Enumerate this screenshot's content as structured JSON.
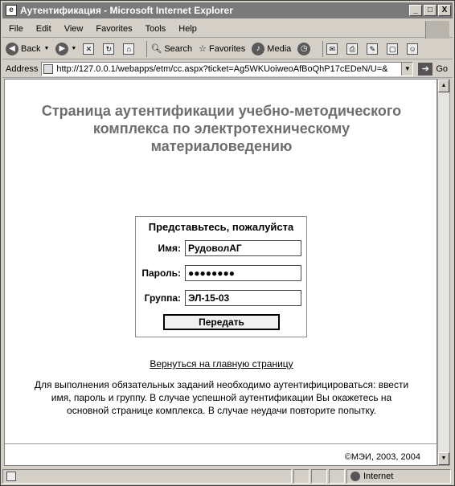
{
  "window": {
    "title": "Аутентификация - Microsoft Internet Explorer",
    "minimize": "_",
    "maximize": "□",
    "close": "X"
  },
  "menu": [
    {
      "label": "File"
    },
    {
      "label": "Edit"
    },
    {
      "label": "View"
    },
    {
      "label": "Favorites"
    },
    {
      "label": "Tools"
    },
    {
      "label": "Help"
    }
  ],
  "toolbar": {
    "back": "Back",
    "search": "Search",
    "favorites": "Favorites",
    "media": "Media"
  },
  "address": {
    "label": "Address",
    "url": "http://127.0.0.1/webapps/etm/cc.aspx?ticket=Ag5WKUoiweoAfBoQhP17cEDeN/U=&",
    "go": "Go"
  },
  "page": {
    "heading_line1": "Страница аутентификации учебно-методического",
    "heading_line2": "комплекса по электротехническому",
    "heading_line3": "материаловедению",
    "form_title": "Представьтесь, пожалуйста",
    "name_label": "Имя:",
    "name_value": "РудоволАГ",
    "password_label": "Пароль:",
    "password_value": "●●●●●●●●",
    "group_label": "Группа:",
    "group_value": "ЭЛ-15-03",
    "submit_label": "Передать",
    "back_link": "Вернуться на главную страницу",
    "info_line1": "Для выполнения обязательных заданий необходимо аутентифицироваться: ввести",
    "info_line2": "имя, пароль и группу. В случае успешной аутентификации Вы окажетесь на",
    "info_line3": "основной странице комплекса. В случае неудачи повторите попытку.",
    "copyright": "©МЭИ, 2003, 2004"
  },
  "status": {
    "zone": "Internet"
  }
}
